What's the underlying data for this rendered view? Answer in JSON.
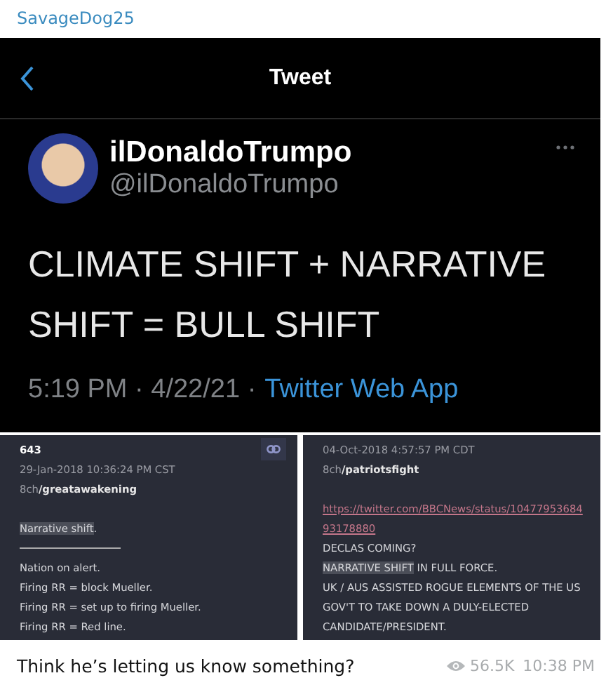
{
  "sender": "SavageDog25",
  "tweet": {
    "header": "Tweet",
    "name": "ilDonaldoTrumpo",
    "handle": "@ilDonaldoTrumpo",
    "text": "CLIMATE SHIFT + NARRATIVE SHIFT = BULL SHIFT",
    "time": "5:19 PM · 4/22/21 ·",
    "source": "Twitter Web App"
  },
  "posts": [
    {
      "number": "643",
      "date": "29-Jan-2018 10:36:24 PM CST",
      "board_prefix": "8ch",
      "board": "/greatawakening",
      "lines": [
        {
          "kind": "highlight",
          "highlight": "Narrative shift",
          "rest": "."
        },
        {
          "kind": "rule"
        },
        {
          "kind": "text",
          "text": "Nation on alert."
        },
        {
          "kind": "text",
          "text": "Firing RR = block Mueller."
        },
        {
          "kind": "text",
          "text": "Firing RR = set up to firing Mueller."
        },
        {
          "kind": "text",
          "text": "Firing RR = Red line."
        }
      ]
    },
    {
      "date": "04-Oct-2018 4:57:57 PM CDT",
      "board_prefix": "8ch",
      "board": "/patriotsfight",
      "lines": [
        {
          "kind": "link",
          "text": "https://twitter.com/BBCNews/status/1047795368493178880"
        },
        {
          "kind": "text",
          "text": "DECLAS COMING?"
        },
        {
          "kind": "highlight",
          "highlight": "NARRATIVE SHIFT",
          "rest": " IN FULL FORCE."
        },
        {
          "kind": "text",
          "text": "UK / AUS ASSISTED ROGUE ELEMENTS OF THE US"
        },
        {
          "kind": "text",
          "text": "GOV'T TO TAKE DOWN A DULY-ELECTED"
        },
        {
          "kind": "text",
          "text": "CANDIDATE/PRESIDENT."
        }
      ]
    }
  ],
  "caption": "Think he’s letting us know something?",
  "views": "56.5K",
  "time": "10:38 PM"
}
